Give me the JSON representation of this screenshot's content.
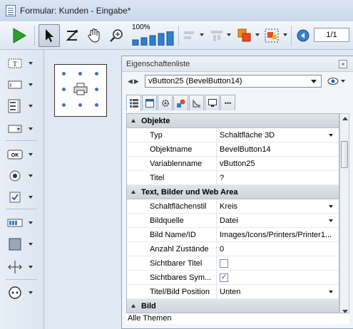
{
  "window": {
    "title": "Formular: Kunden -  Eingabe*"
  },
  "toolbar": {
    "zoom_label": "100%",
    "page_indicator": "1/1"
  },
  "panel": {
    "title": "Eigenschaftenliste",
    "close_label": "×",
    "nav": "◀▶",
    "object_select": "vButton25 (BevelButton14)",
    "tabs_last": "•••",
    "footer": "Alle Themen"
  },
  "properties": {
    "sections": [
      {
        "title": "Objekte"
      },
      {
        "title": "Text, Bilder und Web Area"
      },
      {
        "title": "Bild"
      }
    ],
    "rows": [
      {
        "name": "Typ",
        "value": "Schaltfläche 3D"
      },
      {
        "name": "Objektname",
        "value": "BevelButton14"
      },
      {
        "name": "Variablenname",
        "value": "vButton25"
      },
      {
        "name": "Titel",
        "value": "?"
      },
      {
        "name": "Schaltflächenstil",
        "value": "Kreis"
      },
      {
        "name": "Bildquelle",
        "value": "Datei"
      },
      {
        "name": "Bild Name/ID",
        "value": "Images/Icons/Printers/Printer1..."
      },
      {
        "name": "Anzahl Zustände",
        "value": "0"
      },
      {
        "name": "Sichtbarer Titel",
        "value": ""
      },
      {
        "name": "Sichtbares Sym...",
        "value": "✓"
      },
      {
        "name": "Titel/Bild Position",
        "value": "Unten"
      }
    ]
  },
  "colors": {
    "accent": "#3a73c9",
    "run_green": "#2ca02c"
  }
}
